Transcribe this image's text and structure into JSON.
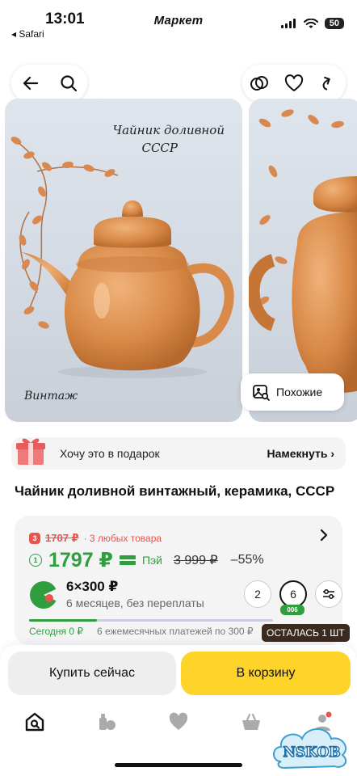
{
  "status_bar": {
    "time": "13:01",
    "back_app": "◂ Safari",
    "brand": "Маркет",
    "battery": "50"
  },
  "gallery": {
    "caption_top_line1": "Чайник доливной",
    "caption_top_line2": "СССР",
    "caption_bottom": "Винтаж",
    "similar_label": "Похожие"
  },
  "gift": {
    "text": "Хочу это в подарок",
    "hint": "Намекнуть"
  },
  "product": {
    "title": "Чайник доливной винтажный, керамика, СССР"
  },
  "price": {
    "promo_badge": "3",
    "promo_price": "1707 ₽",
    "promo_label": "· 3 любых товара",
    "count": "1",
    "main_price": "1797 ₽",
    "pay_label": "Пэй",
    "old_price": "3 999 ₽",
    "discount": "–55%"
  },
  "split": {
    "amount": "6×300 ₽",
    "desc": "6 месяцев, без переплаты",
    "term_options": [
      "2",
      "6"
    ],
    "selected_badge": "006",
    "today": "Сегодня 0 ₽",
    "rest": "6 ежемесячных платежей по 300 ₽"
  },
  "stock": {
    "label": "ОСТАЛАСЬ 1 ШТ"
  },
  "actions": {
    "buy_now": "Купить сейчас",
    "add_to_cart": "В корзину"
  },
  "watermark": {
    "text": "NSKOB"
  },
  "colors": {
    "green": "#2e9e3e",
    "yellow": "#fed42b",
    "red": "#e8554e"
  }
}
